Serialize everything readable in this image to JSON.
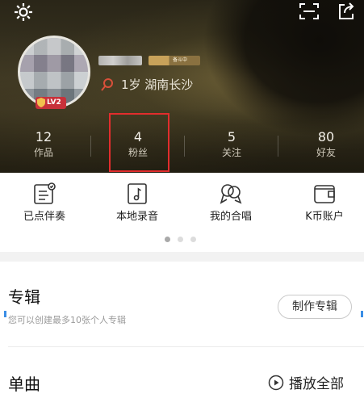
{
  "header": {
    "level_badge": "LV2",
    "singing_badge": "备斗中",
    "location": "1岁 湖南长沙"
  },
  "stats": [
    {
      "value": "12",
      "label": "作品"
    },
    {
      "value": "4",
      "label": "粉丝"
    },
    {
      "value": "5",
      "label": "关注"
    },
    {
      "value": "80",
      "label": "好友"
    }
  ],
  "quick_actions": [
    {
      "label": "已点伴奏",
      "icon": "accompaniment-list-icon"
    },
    {
      "label": "本地录音",
      "icon": "local-recording-icon"
    },
    {
      "label": "我的合唱",
      "icon": "chorus-icon"
    },
    {
      "label": "K币账户",
      "icon": "wallet-icon"
    }
  ],
  "pager": {
    "total": 3,
    "active": 0
  },
  "album": {
    "title": "专辑",
    "subtitle": "您可以创建最多10张个人专辑",
    "button": "制作专辑"
  },
  "singles": {
    "title": "单曲",
    "play_all": "播放全部"
  },
  "colors": {
    "highlight": "#e22d2d",
    "level_badge": "#c8313a",
    "pin": "#d9503a"
  }
}
